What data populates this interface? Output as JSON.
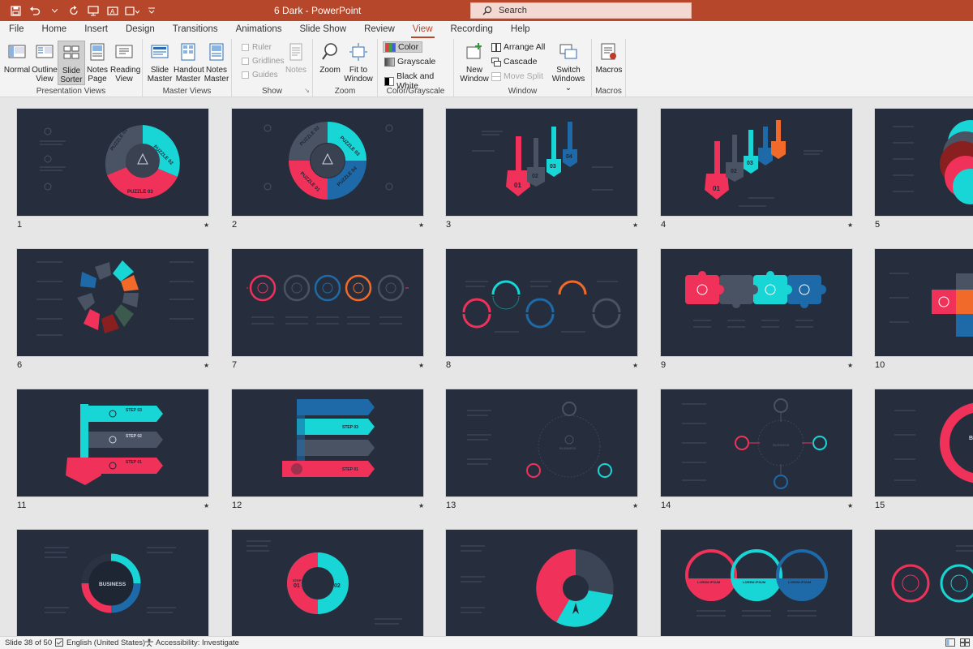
{
  "app": {
    "title": "6 Dark  -  PowerPoint",
    "search_placeholder": "Search"
  },
  "tabs": [
    "File",
    "Home",
    "Insert",
    "Design",
    "Transitions",
    "Animations",
    "Slide Show",
    "Review",
    "View",
    "Recording",
    "Help"
  ],
  "active_tab": "View",
  "ribbon": {
    "presentation_views": {
      "label": "Presentation Views",
      "normal": "Normal",
      "outline": "Outline View",
      "outline_1": "Outline",
      "outline_2": "View",
      "sorter_1": "Slide",
      "sorter_2": "Sorter",
      "notes_1": "Notes",
      "notes_2": "Page",
      "reading_1": "Reading",
      "reading_2": "View"
    },
    "master_views": {
      "label": "Master Views",
      "slide_1": "Slide",
      "slide_2": "Master",
      "handout_1": "Handout",
      "handout_2": "Master",
      "notes_1": "Notes",
      "notes_2": "Master"
    },
    "show": {
      "label": "Show",
      "ruler": "Ruler",
      "gridlines": "Gridlines",
      "guides": "Guides",
      "notes": "Notes"
    },
    "zoom": {
      "label": "Zoom",
      "zoom": "Zoom",
      "fit_1": "Fit to",
      "fit_2": "Window"
    },
    "color_grayscale": {
      "label": "Color/Grayscale",
      "color": "Color",
      "grayscale": "Grayscale",
      "bw": "Black and White"
    },
    "window": {
      "label": "Window",
      "new_1": "New",
      "new_2": "Window",
      "arrange_all": "Arrange All",
      "cascade": "Cascade",
      "move_split": "Move Split",
      "switch_1": "Switch",
      "switch_2": "Windows ⌄"
    },
    "macros": {
      "label": "Macros",
      "macros": "Macros"
    }
  },
  "slides": {
    "s1": "1",
    "s2": "2",
    "s3": "3",
    "s4": "4",
    "s5": "5",
    "s6": "6",
    "s7": "7",
    "s8": "8",
    "s9": "9",
    "s10": "10",
    "s11": "11",
    "s12": "12",
    "s13": "13",
    "s14": "14",
    "s15": "15",
    "star": "★"
  },
  "slide_text": {
    "puzzle_01": "PUZZLE 01",
    "puzzle_02": "PUZZLE 02",
    "puzzle_03": "PUZZLE 03",
    "puzzle_04": "PUZZLE 04",
    "key_01": "01",
    "key_02": "02",
    "key_03": "03",
    "key_04": "04",
    "step_01": "STEP 01",
    "step_02": "STEP 02",
    "step_03": "STEP 03",
    "business": "BUSINESS",
    "lorem": "LOREM IPSUM",
    "half_01": "01",
    "half_02": "02"
  },
  "status": {
    "slide_count": "Slide 38 of 50",
    "language": "English (United States)",
    "accessibility": "Accessibility: Investigate"
  },
  "colors": {
    "brand": "#b7472a",
    "slide_bg": "#262e3d",
    "pink": "#f0325a",
    "cyan": "#18d6d6",
    "blue": "#1e6aa8",
    "orange": "#f26a2a",
    "gray": "#4a5363",
    "dark_red": "#8a1f1f"
  }
}
